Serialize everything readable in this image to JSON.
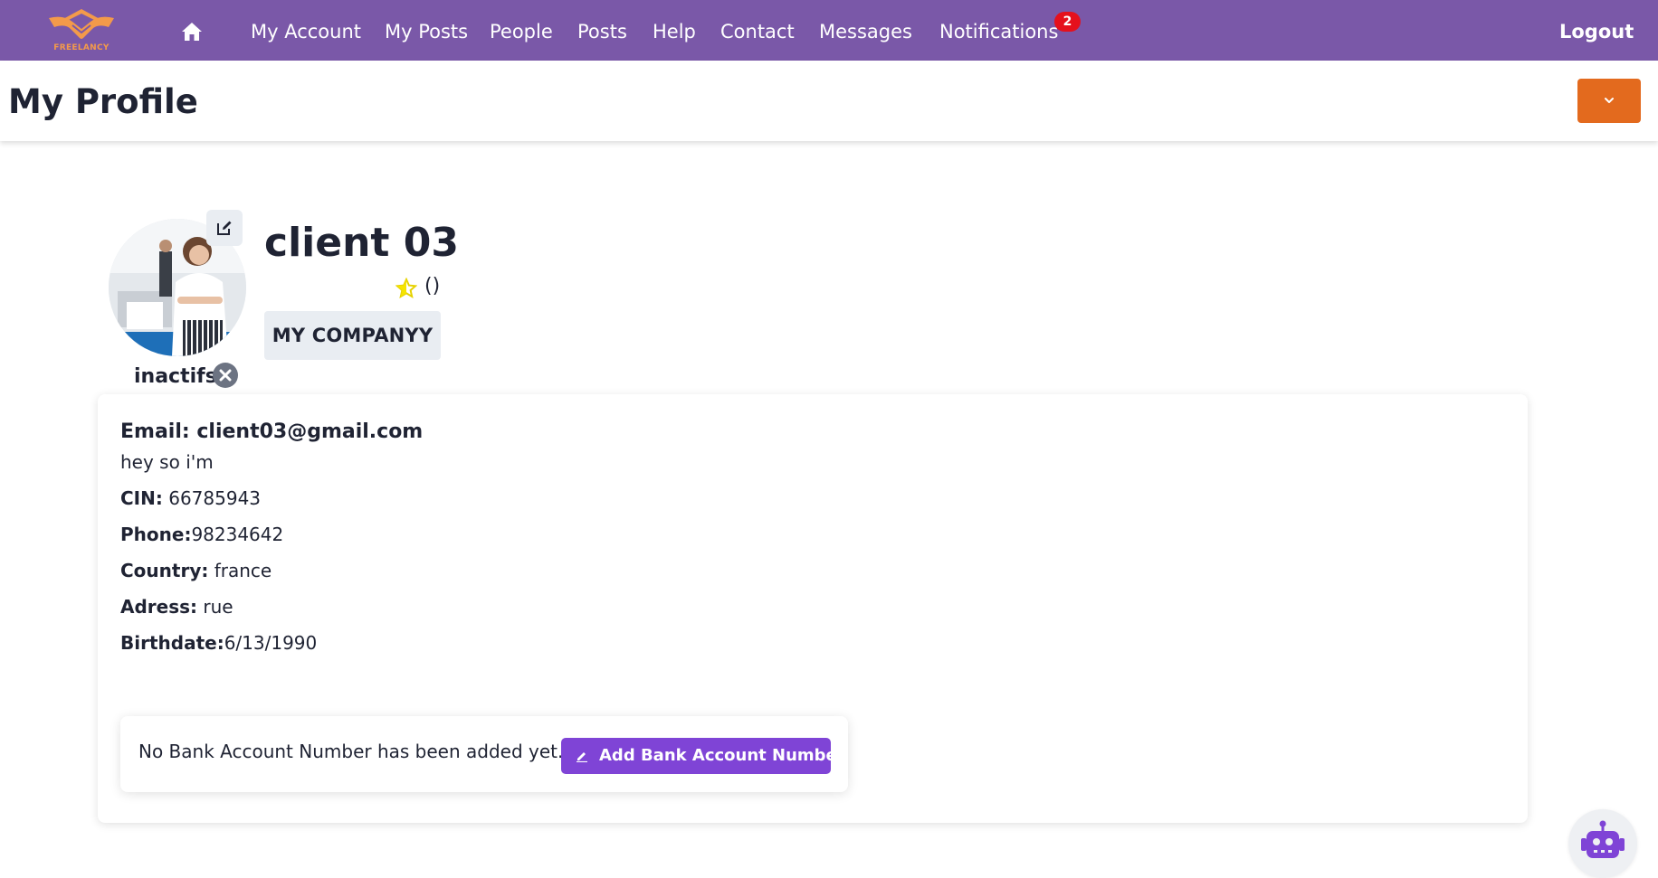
{
  "brand": {
    "logo_text": "FREELANCY",
    "color": "#7a58a8",
    "accent": "#f39a4a"
  },
  "nav": {
    "home_icon": "home-icon",
    "items": [
      {
        "label": "My Account"
      },
      {
        "label": "My Posts"
      },
      {
        "label": "People"
      },
      {
        "label": "Posts"
      },
      {
        "label": "Help"
      },
      {
        "label": "Contact"
      },
      {
        "label": "Messages"
      },
      {
        "label": "Notifications"
      }
    ],
    "notifications_count": "2",
    "logout_label": "Logout"
  },
  "header": {
    "title": "My Profile",
    "dropdown_icon": "chevron-down-icon",
    "button_color": "#e36a1e"
  },
  "profile": {
    "name": "client 03",
    "rating_text": "()",
    "company": "MY COMPANYY",
    "status": "inactifs",
    "status_icon": "close-circle-icon",
    "edit_icon": "edit-icon"
  },
  "info": {
    "email_label": "Email:",
    "email_value": "client03@gmail.com",
    "bio": "hey so i'm",
    "cin_label": "CIN:",
    "cin_value": "66785943",
    "phone_label": "Phone:",
    "phone_value": "98234642",
    "country_label": "Country:",
    "country_value": "france",
    "address_label": "Adress:",
    "address_value": "rue",
    "birthdate_label": "Birthdate:",
    "birthdate_value": "6/13/1990"
  },
  "bank": {
    "message": "No Bank Account Number has been added yet.",
    "button_label": "Add Bank Account Number",
    "button_color": "#7f44d6"
  },
  "chatbot": {
    "icon": "robot-icon",
    "color": "#7f44d6"
  }
}
